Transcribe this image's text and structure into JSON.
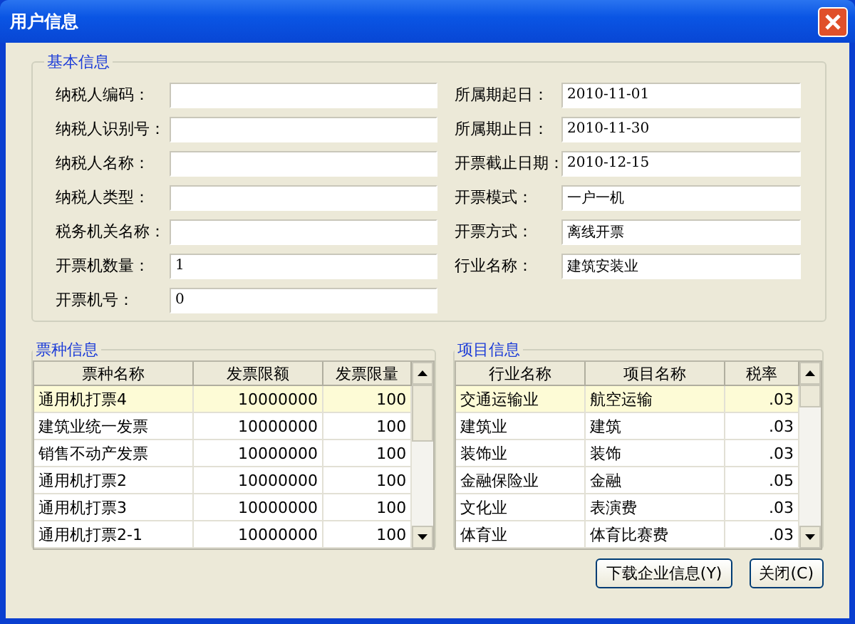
{
  "window": {
    "title": "用户信息"
  },
  "basic_info": {
    "title": "基本信息",
    "left_fields": [
      {
        "label": "纳税人编码："
      },
      {
        "label": "纳税人识别号："
      },
      {
        "label": "纳税人名称："
      },
      {
        "label": "纳税人类型："
      },
      {
        "label": "税务机关名称："
      },
      {
        "label": "开票机数量：",
        "value": "1"
      },
      {
        "label": "开票机号：",
        "value": "0"
      }
    ],
    "right_fields": [
      {
        "label": "所属期起日：",
        "value": "2010-11-01"
      },
      {
        "label": "所属期止日：",
        "value": "2010-11-30"
      },
      {
        "label": "开票截止日期：",
        "value": "2010-12-15"
      },
      {
        "label": "开票模式：",
        "value": "一户一机"
      },
      {
        "label": "开票方式：",
        "value": "离线开票"
      },
      {
        "label": "行业名称：",
        "value": "建筑安装业"
      }
    ]
  },
  "ticket_types": {
    "title": "票种信息",
    "columns": [
      "票种名称",
      "发票限额",
      "发票限量"
    ],
    "rows": [
      {
        "cells": [
          "通用机打票4",
          "10000000",
          "100"
        ],
        "selected": true
      },
      {
        "cells": [
          "建筑业统一发票",
          "10000000",
          "100"
        ],
        "selected": false
      },
      {
        "cells": [
          "销售不动产发票",
          "10000000",
          "100"
        ],
        "selected": false
      },
      {
        "cells": [
          "通用机打票2",
          "10000000",
          "100"
        ],
        "selected": false
      },
      {
        "cells": [
          "通用机打票3",
          "10000000",
          "100"
        ],
        "selected": false
      },
      {
        "cells": [
          "通用机打票2-1",
          "10000000",
          "100"
        ],
        "selected": false
      }
    ]
  },
  "items": {
    "title": "项目信息",
    "columns": [
      "行业名称",
      "项目名称",
      "税率"
    ],
    "rows": [
      {
        "cells": [
          "交通运输业",
          "航空运输",
          ".03"
        ],
        "selected": true
      },
      {
        "cells": [
          "建筑业",
          "建筑",
          ".03"
        ],
        "selected": false
      },
      {
        "cells": [
          "装饰业",
          "装饰",
          ".03"
        ],
        "selected": false
      },
      {
        "cells": [
          "金融保险业",
          "金融",
          ".05"
        ],
        "selected": false
      },
      {
        "cells": [
          "文化业",
          "表演费",
          ".03"
        ],
        "selected": false
      },
      {
        "cells": [
          "体育业",
          "体育比赛费",
          ".03"
        ],
        "selected": false
      }
    ]
  },
  "buttons": [
    "下载企业信息(Y)",
    "关闭(C)"
  ]
}
